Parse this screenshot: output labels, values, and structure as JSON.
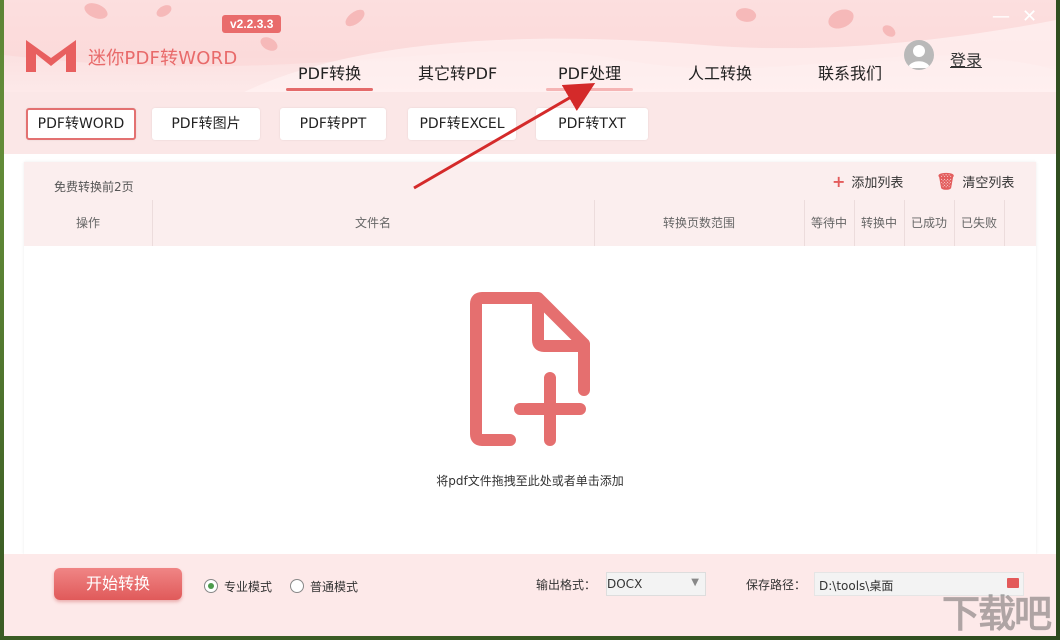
{
  "app": {
    "name": "迷你PDF转WORD",
    "version": "v2.2.3.3"
  },
  "nav": {
    "items": [
      {
        "label": "PDF转换"
      },
      {
        "label": "其它转PDF"
      },
      {
        "label": "PDF处理"
      },
      {
        "label": "人工转换"
      },
      {
        "label": "联系我们"
      }
    ]
  },
  "user": {
    "login_label": "登录"
  },
  "window_controls": {
    "minimize": "—",
    "close": "✕"
  },
  "subtabs": [
    {
      "label": "PDF转WORD"
    },
    {
      "label": "PDF转图片"
    },
    {
      "label": "PDF转PPT"
    },
    {
      "label": "PDF转EXCEL"
    },
    {
      "label": "PDF转TXT"
    }
  ],
  "panel": {
    "free_note": "免费转换前2页",
    "add_list": "添加列表",
    "clear_list": "清空列表",
    "columns": [
      "操作",
      "文件名",
      "转换页数范围",
      "等待中",
      "转换中",
      "已成功",
      "已失败"
    ],
    "drop_text": "将pdf文件拖拽至此处或者单击添加"
  },
  "bottom": {
    "start_label": "开始转换",
    "mode_pro": "专业模式",
    "mode_normal": "普通模式",
    "output_format_label": "输出格式：",
    "output_format_value": "DOCX",
    "save_path_label": "保存路径：",
    "save_path_value": "D:\\tools\\桌面"
  },
  "watermark": "下载吧",
  "colors": {
    "accent": "#e46a6a",
    "header_bg": "#fbe4e4",
    "arrow": "#d42a2a"
  }
}
